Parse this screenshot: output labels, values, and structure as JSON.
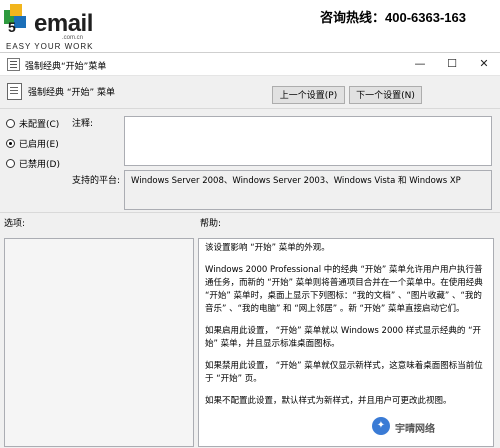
{
  "banner": {
    "logo_text": "email",
    "logo_sub": ".com.cn",
    "slogan": "EASY YOUR WORK",
    "hotline": "咨询热线：400-6363-163"
  },
  "window": {
    "title": "强制经典“开始”菜单",
    "minimize": "—",
    "maximize": "☐",
    "close": "✕"
  },
  "header": {
    "policy_title": "强制经典 “开始” 菜单",
    "prev_button": "上一个设置(P)",
    "next_button": "下一个设置(N)"
  },
  "options": {
    "not_configured": "未配置(C)",
    "enabled": "已启用(E)",
    "disabled": "已禁用(D)",
    "selected": "enabled"
  },
  "comment_label": "注释:",
  "platform_label": "支持的平台:",
  "platform_value": "Windows Server 2008、Windows Server 2003、Windows Vista 和 Windows XP",
  "options_label": "选项:",
  "help_label": "帮助:",
  "help_paragraphs": [
    "该设置影响 “开始” 菜单的外观。",
    "Windows 2000 Professional 中的经典 “开始” 菜单允许用户用户执行普通任务，而新的 “开始” 菜单则将普通项目合并在一个菜单中。在使用经典 “开始” 菜单时，桌面上显示下列图标：“我的文档” 、“图片收藏” 、“我的音乐” 、“我的电脑” 和 “网上邻居” 。新 “开始” 菜单直接启动它们。",
    "如果启用此设置， “开始” 菜单就以 Windows 2000 样式显示经典的 “开始” 菜单，并且显示标准桌面图标。",
    "如果禁用此设置， “开始” 菜单就仅显示新样式，这意味着桌面图标当前位于 “开始” 页。",
    "如果不配置此设置，默认样式为新样式，并且用户可更改此视图。"
  ],
  "watermark": "宇晴网络"
}
